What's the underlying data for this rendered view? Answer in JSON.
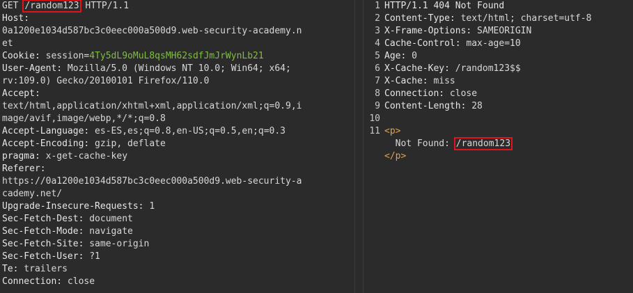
{
  "request": {
    "method": "GET",
    "path": "/random123",
    "protocol": "HTTP/1.1",
    "lines": [
      {
        "k": "Host:",
        "v": ""
      },
      {
        "k": "",
        "v": "0a1200e1034d587bc3c0eec000a500d9.web-security-academy.n"
      },
      {
        "k": "",
        "v": "et"
      },
      {
        "k": "Cookie:",
        "cookie_name": "session",
        "cookie_value": "4Ty5dL9oMuL8qsMH62sdfJmJrWynLb21"
      },
      {
        "k": "User-Agent:",
        "v": " Mozilla/5.0 (Windows NT 10.0; Win64; x64;"
      },
      {
        "k": "",
        "v": "rv:109.0) Gecko/20100101 Firefox/110.0"
      },
      {
        "k": "Accept:",
        "v": ""
      },
      {
        "k": "",
        "v": "text/html,application/xhtml+xml,application/xml;q=0.9,i"
      },
      {
        "k": "",
        "v": "mage/avif,image/webp,*/*;q=0.8"
      },
      {
        "k": "Accept-Language:",
        "v": " es-ES,es;q=0.8,en-US;q=0.5,en;q=0.3"
      },
      {
        "k": "Accept-Encoding:",
        "v": " gzip, deflate"
      },
      {
        "k": "pragma:",
        "v": " x-get-cache-key"
      },
      {
        "k": "Referer:",
        "v": ""
      },
      {
        "k": "",
        "v": "https://0a1200e1034d587bc3c0eec000a500d9.web-security-a"
      },
      {
        "k": "",
        "v": "cademy.net/"
      },
      {
        "k": "Upgrade-Insecure-Requests:",
        "v": " 1"
      },
      {
        "k": "Sec-Fetch-Dest:",
        "v": " document"
      },
      {
        "k": "Sec-Fetch-Mode:",
        "v": " navigate"
      },
      {
        "k": "Sec-Fetch-Site:",
        "v": " same-origin"
      },
      {
        "k": "Sec-Fetch-User:",
        "v": " ?1"
      },
      {
        "k": "Te:",
        "v": " trailers"
      },
      {
        "k": "Connection:",
        "v": " close"
      }
    ]
  },
  "response": {
    "lines": [
      {
        "n": "1",
        "k": "HTTP/1.1 404 Not Found",
        "v": ""
      },
      {
        "n": "2",
        "k": "Content-Type:",
        "v": " text/html; charset=utf-8"
      },
      {
        "n": "3",
        "k": "X-Frame-Options:",
        "v": " SAMEORIGIN"
      },
      {
        "n": "4",
        "k": "Cache-Control:",
        "v": " max-age=10"
      },
      {
        "n": "5",
        "k": "Age:",
        "v": " 0"
      },
      {
        "n": "6",
        "k": "X-Cache-Key:",
        "v": " /random123$$"
      },
      {
        "n": "7",
        "k": "X-Cache:",
        "v": " miss"
      },
      {
        "n": "8",
        "k": "Connection:",
        "v": " close"
      },
      {
        "n": "9",
        "k": "Content-Length:",
        "v": " 28"
      },
      {
        "n": "10",
        "k": "",
        "v": ""
      }
    ],
    "body": {
      "n": "11",
      "open_tag": "<p>",
      "text": "  Not Found: ",
      "path": "/random123",
      "close_tag": "</p>"
    }
  },
  "colors": {
    "highlight": "#e0141a",
    "cookie_value": "#7fbf3f",
    "html_tag": "#e0a050"
  }
}
